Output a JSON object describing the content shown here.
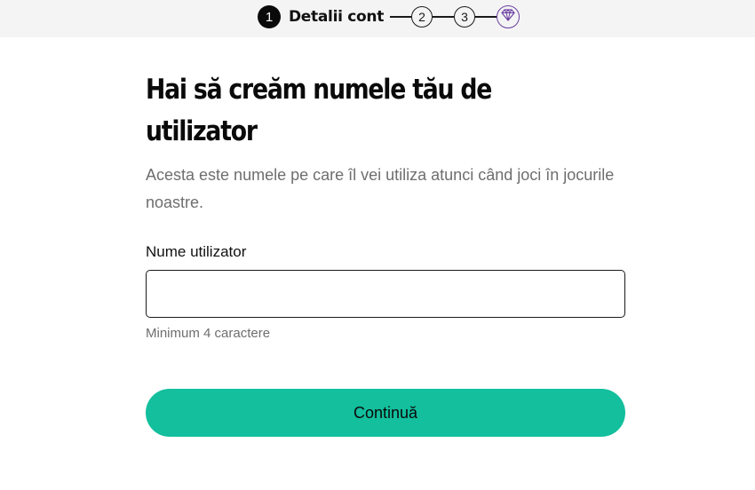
{
  "stepper": {
    "steps": [
      {
        "number": "1",
        "label": "Detalii cont",
        "state": "active"
      },
      {
        "number": "2",
        "state": "pending"
      },
      {
        "number": "3",
        "state": "pending"
      },
      {
        "icon": "diamond-icon",
        "state": "final"
      }
    ]
  },
  "main": {
    "title": "Hai să creăm numele tău de utilizator",
    "subtitle": "Acesta este numele pe care îl vei utiliza atunci când joci în jocurile noastre.",
    "username_field": {
      "label": "Nume utilizator",
      "value": "",
      "hint": "Minimum 4 caractere"
    },
    "continue_button": "Continuă"
  },
  "colors": {
    "accent": "#13bf9d",
    "gem": "#6b3fa0",
    "stepper_background": "#f4f4f4",
    "muted_text": "#6e6e6e"
  }
}
